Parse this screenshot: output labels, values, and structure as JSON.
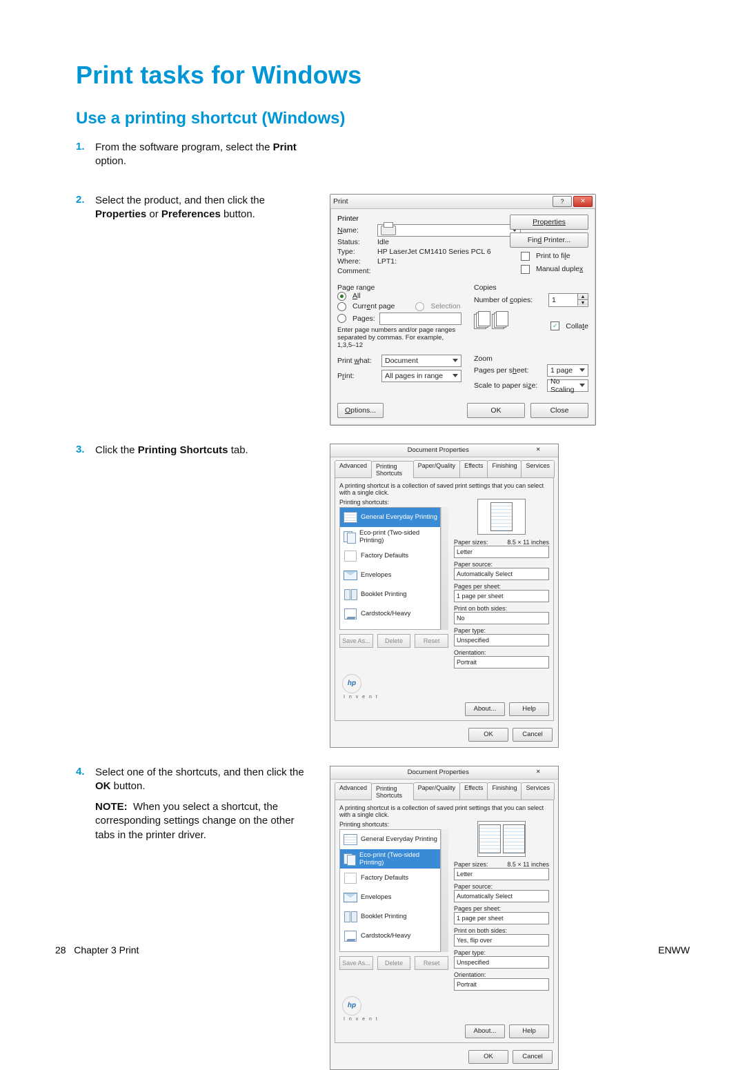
{
  "headings": {
    "h1": "Print tasks for Windows",
    "h2": "Use a printing shortcut (Windows)"
  },
  "steps": [
    {
      "num": "1.",
      "text_before": "From the software program, select the ",
      "bold": "Print",
      "text_after": " option."
    },
    {
      "num": "2.",
      "text_before": "Select the product, and then click the ",
      "bold": "Properties",
      "mid": " or ",
      "bold2": "Preferences",
      "text_after": " button."
    },
    {
      "num": "3.",
      "text_before": "Click the ",
      "bold": "Printing Shortcuts",
      "text_after": " tab."
    },
    {
      "num": "4.",
      "text_before": "Select one of the shortcuts, and then click the ",
      "bold": "OK",
      "text_after": " button.",
      "note": {
        "lead": "NOTE:",
        "body": "When you select a shortcut, the corresponding settings change on the other tabs in the printer driver."
      }
    }
  ],
  "print_dialog": {
    "title": "Print",
    "printer": {
      "section": "Printer",
      "name_label": "Name:",
      "name_value": "",
      "status_label": "Status:",
      "status_value": "Idle",
      "type_label": "Type:",
      "type_value": "HP LaserJet CM1410 Series PCL 6",
      "where_label": "Where:",
      "where_value": "LPT1:",
      "comment_label": "Comment:",
      "properties_btn": "Properties",
      "find_printer_btn": "Find Printer...",
      "print_to_file": "Print to file",
      "manual_duplex": "Manual duplex"
    },
    "page_range": {
      "section": "Page range",
      "all": "All",
      "current": "Current page",
      "selection": "Selection",
      "pages": "Pages:",
      "hint1": "Enter page numbers and/or page ranges",
      "hint2": "separated by commas.  For example, 1,3,5–12"
    },
    "copies": {
      "section": "Copies",
      "num_label": "Number of copies:",
      "num_value": "1",
      "collate": "Collate"
    },
    "print_what_label": "Print what:",
    "print_what_value": "Document",
    "print_label": "Print:",
    "print_value": "All pages in range",
    "zoom": {
      "section": "Zoom",
      "pps_label": "Pages per sheet:",
      "pps_value": "1 page",
      "scale_label": "Scale to paper size:",
      "scale_value": "No Scaling"
    },
    "options_btn": "Options...",
    "ok_btn": "OK",
    "close_btn": "Close"
  },
  "doc_props": {
    "title": "Document Properties",
    "tabs": [
      "Advanced",
      "Printing Shortcuts",
      "Paper/Quality",
      "Effects",
      "Finishing",
      "Services"
    ],
    "desc": "A printing shortcut is a collection of saved print settings that you can select with a single click.",
    "list_label": "Printing shortcuts:",
    "shortcuts": [
      "General Everyday Printing",
      "Eco-print (Two-sided Printing)",
      "Factory Defaults",
      "Envelopes",
      "Booklet Printing",
      "Cardstock/Heavy"
    ],
    "save_btn": "Save As...",
    "delete_btn": "Delete",
    "reset_btn": "Reset",
    "paper_sizes_label": "Paper sizes:",
    "paper_sizes_dim": "8.5 × 11 inches",
    "paper_source_label": "Paper source:",
    "pages_per_sheet_label": "Pages per sheet:",
    "print_both_label": "Print on both sides:",
    "paper_type_label": "Paper type:",
    "orientation_label": "Orientation:",
    "about_btn": "About...",
    "help_btn": "Help",
    "ok_btn": "OK",
    "cancel_btn": "Cancel",
    "hp_logo": "hp",
    "hp_sub": "I n v e n t",
    "fig2": {
      "selected_index": 0,
      "paper_size": "Letter",
      "paper_source": "Automatically Select",
      "pages_per_sheet": "1 page per sheet",
      "both_sides": "No",
      "paper_type": "Unspecified",
      "orientation": "Portrait"
    },
    "fig3": {
      "selected_index": 1,
      "paper_size": "Letter",
      "paper_source": "Automatically Select",
      "pages_per_sheet": "1 page per sheet",
      "both_sides": "Yes, flip over",
      "paper_type": "Unspecified",
      "orientation": "Portrait"
    }
  },
  "footer": {
    "page_no": "28",
    "chapter": "Chapter 3   Print",
    "right": "ENWW"
  }
}
